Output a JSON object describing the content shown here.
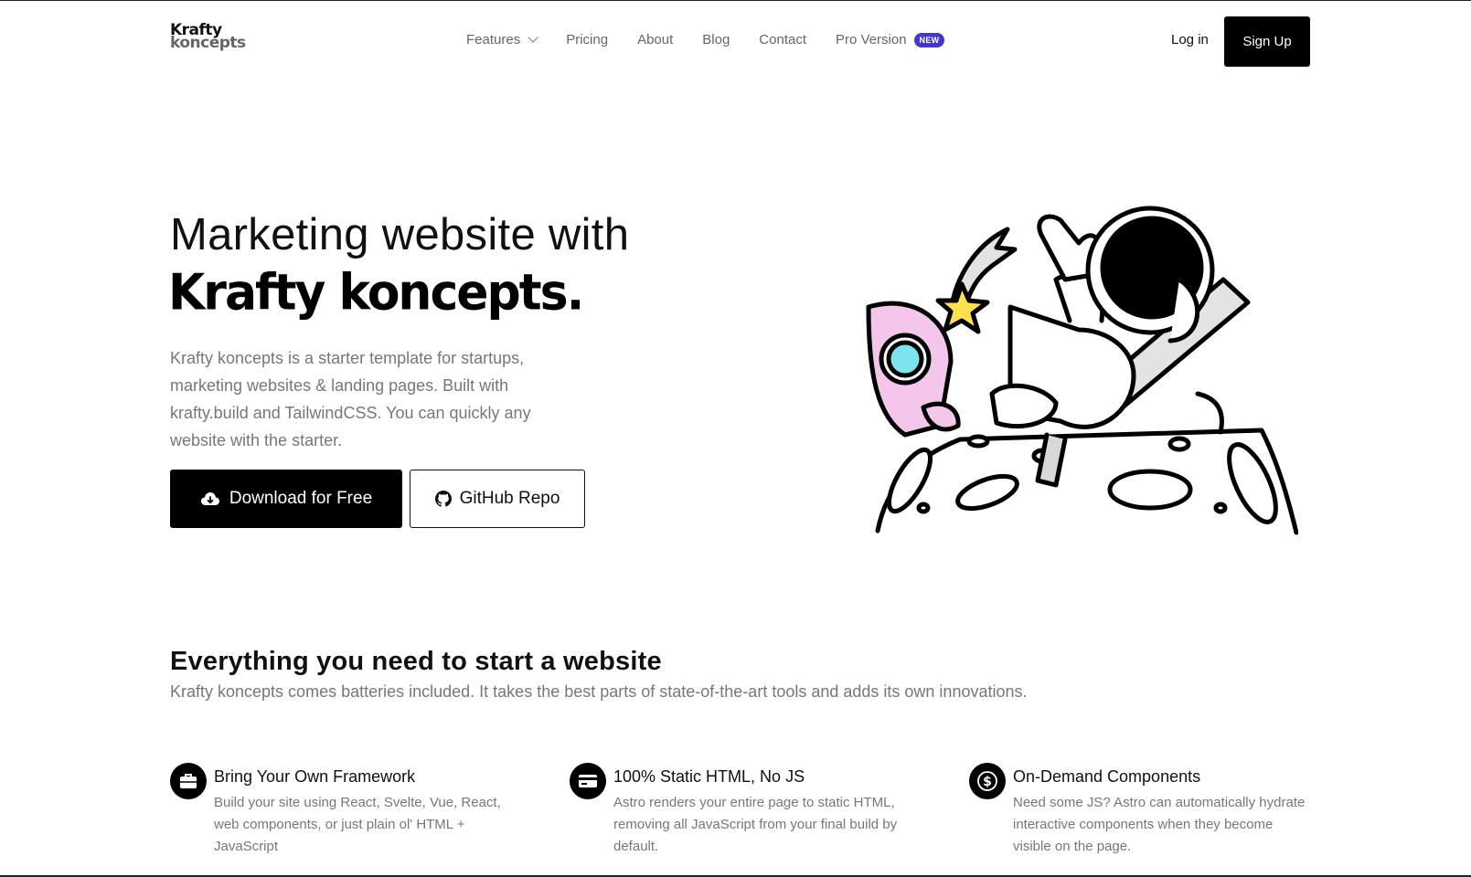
{
  "header": {
    "logo": {
      "line1": "Krafty",
      "line2": "koncepts"
    },
    "nav": [
      {
        "label": "Features",
        "has_dropdown": true
      },
      {
        "label": "Pricing"
      },
      {
        "label": "About"
      },
      {
        "label": "Blog"
      },
      {
        "label": "Contact"
      },
      {
        "label": "Pro Version",
        "badge": "NEW"
      }
    ],
    "login_label": "Log in",
    "signup_label": "Sign Up"
  },
  "hero": {
    "title_line1": "Marketing website with",
    "title_line2": "Krafty koncepts.",
    "description": "Krafty koncepts is a starter template for startups, marketing websites & landing pages. Built with krafty.build and TailwindCSS. You can quickly any website with the starter.",
    "download_label": "Download for Free",
    "github_label": "GitHub Repo",
    "download_icon": "cloud-download-icon",
    "github_icon": "github-icon",
    "illustration": "astronaut-relaxing-on-moon-with-rocket"
  },
  "features": {
    "title": "Everything you need to start a website",
    "subtitle": "Krafty koncepts comes batteries included. It takes the best parts of state-of-the-art tools and adds its own innovations.",
    "items": [
      {
        "icon": "briefcase-icon",
        "title": "Bring Your Own Framework",
        "description": "Build your site using React, Svelte, Vue, React, web components, or just plain ol' HTML + JavaScript"
      },
      {
        "icon": "credit-card-icon",
        "title": "100% Static HTML, No JS",
        "description": "Astro renders your entire page to static HTML, removing all JavaScript from your final build by default."
      },
      {
        "icon": "dollar-coin-icon",
        "title": "On-Demand Components",
        "description": "Need some JS? Astro can automatically hydrate interactive components when they become visible on the page."
      }
    ]
  },
  "colors": {
    "accent_badge": "#4338ca",
    "primary": "#000000",
    "muted_text": "#777777",
    "rocket_pink": "#f5c6ec",
    "rocket_window": "#7de3ee",
    "star": "#ffe14d"
  }
}
